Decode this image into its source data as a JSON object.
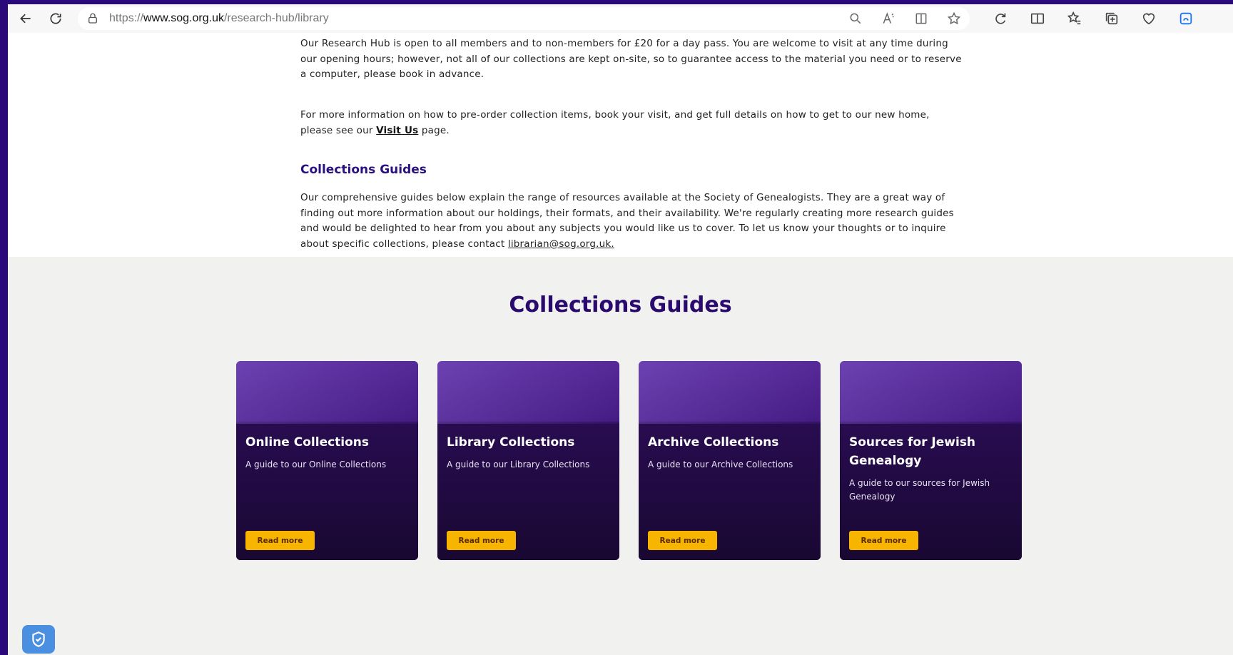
{
  "browser": {
    "url_proto": "https://",
    "url_host": "www.sog.org.uk",
    "url_path": "/research-hub/library"
  },
  "intro": {
    "p1": "Our Research Hub is open to all members and to non-members for £20 for a day pass. You are welcome to visit at any time during our opening hours; however, not all of our collections are kept on-site, so to guarantee access to the material you need or to reserve a computer, please book in advance.",
    "p2_before": "For more information on how to pre-order collection items, book your visit, and get full details on how to get to our new home, please see our ",
    "p2_link": "Visit Us",
    "p2_after": " page.",
    "subhead": "Collections Guides",
    "p3_before": "Our comprehensive guides below explain the range of resources available at the Society of Genealogists. They are a great way of finding out more information about our holdings, their formats, and their availability. We're regularly creating more research guides and would be delighted to hear from you about any subjects you would like us to cover. To let us know your thoughts or to inquire about specific collections, please contact ",
    "p3_email": "librarian@sog.org.uk."
  },
  "guides": {
    "title": "Collections Guides",
    "cards": [
      {
        "title": "Online Collections",
        "desc": "A guide to our Online Collections",
        "button": "Read more"
      },
      {
        "title": "Library Collections",
        "desc": "A guide to our Library Collections",
        "button": "Read more"
      },
      {
        "title": "Archive Collections",
        "desc": "A guide to our Archive Collections",
        "button": "Read more"
      },
      {
        "title": "Sources for Jewish Genealogy",
        "desc": "A guide to our sources for Jewish Genealogy",
        "button": "Read more"
      }
    ]
  },
  "colors": {
    "accent": "#f7b500",
    "heading": "#2a0a6e",
    "card_bg": "#1f0a3e"
  }
}
